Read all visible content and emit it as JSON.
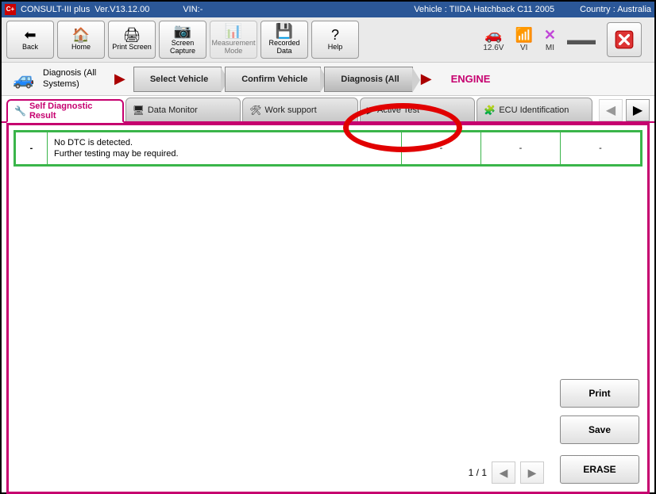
{
  "titlebar": {
    "app": "CONSULT-III plus",
    "version": "Ver.V13.12.00",
    "vin_label": "VIN:-",
    "vehicle_label": "Vehicle : TIIDA Hatchback C11 2005",
    "country_label": "Country : Australia"
  },
  "toolbar": {
    "back": "Back",
    "home": "Home",
    "print_screen": "Print Screen",
    "screen_capture": "Screen Capture",
    "measurement_mode": "Measurement Mode",
    "recorded_data": "Recorded Data",
    "help": "Help"
  },
  "status": {
    "voltage": "12.6V",
    "vi": "VI",
    "mi": "MI"
  },
  "breadcrumb": {
    "start": "Diagnosis (All Systems)",
    "steps": [
      "Select Vehicle",
      "Confirm Vehicle",
      "Diagnosis (All"
    ],
    "system": "ENGINE"
  },
  "tabs": {
    "self_diag": "Self Diagnostic Result",
    "data_monitor": "Data Monitor",
    "work_support": "Work support",
    "active_test": "Active Test",
    "ecu_id": "ECU Identification"
  },
  "result": {
    "code": "-",
    "message": "No DTC is detected.\nFurther testing may be required.",
    "c1": "-",
    "c2": "-",
    "c3": "-"
  },
  "actions": {
    "print": "Print",
    "save": "Save",
    "erase": "ERASE"
  },
  "pager": {
    "text": "1 / 1"
  }
}
